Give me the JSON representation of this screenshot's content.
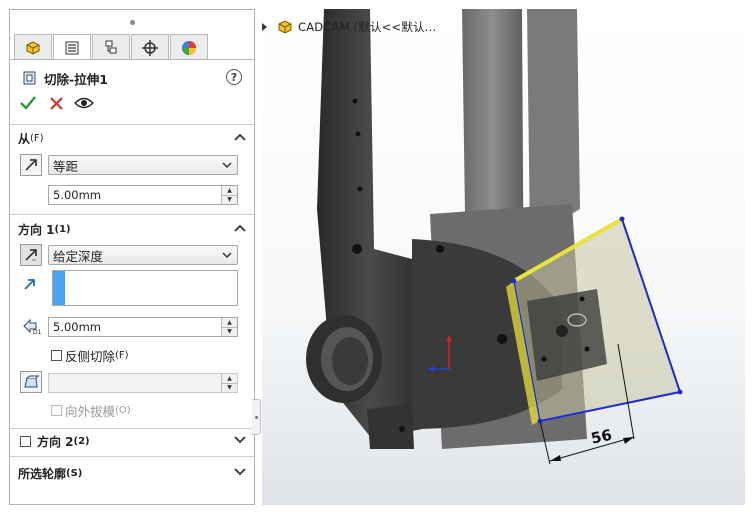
{
  "feature": {
    "title": "切除-拉伸1",
    "help_label": "?"
  },
  "tabs": [
    {
      "name": "featuremanager-tab",
      "icon": "part-icon"
    },
    {
      "name": "propertymanager-tab",
      "icon": "property-list-icon"
    },
    {
      "name": "configuration-tab",
      "icon": "configuration-icon"
    },
    {
      "name": "dimxpert-tab",
      "icon": "crosshair-icon"
    },
    {
      "name": "display-tab",
      "icon": "appearance-icon"
    }
  ],
  "sections": {
    "from": {
      "label": "从",
      "shortcut": "(F)",
      "condition": "等距",
      "offset": "5.00mm"
    },
    "direction1": {
      "label": "方向 1",
      "shortcut": "(1)",
      "end_condition": "给定深度",
      "depth": "5.00mm",
      "flip_side_label": "反侧切除",
      "flip_side_shortcut": "(F)",
      "draft_value": "",
      "draft_outward_label": "向外拔模",
      "draft_outward_shortcut": "(O)"
    },
    "direction2": {
      "label": "方向 2",
      "shortcut": "(2)"
    },
    "selected_contours": {
      "label": "所选轮廓",
      "shortcut": "(S)"
    }
  },
  "viewport": {
    "tree_label": "CADCAM (默认<<默认...",
    "dimension": "56"
  },
  "colors": {
    "accept": "#2e9a2e",
    "cancel": "#d0312d",
    "selection": "#4aa3f0",
    "edge_highlight": "#1c2bd8",
    "sketch_yellow": "#e8e23a"
  }
}
